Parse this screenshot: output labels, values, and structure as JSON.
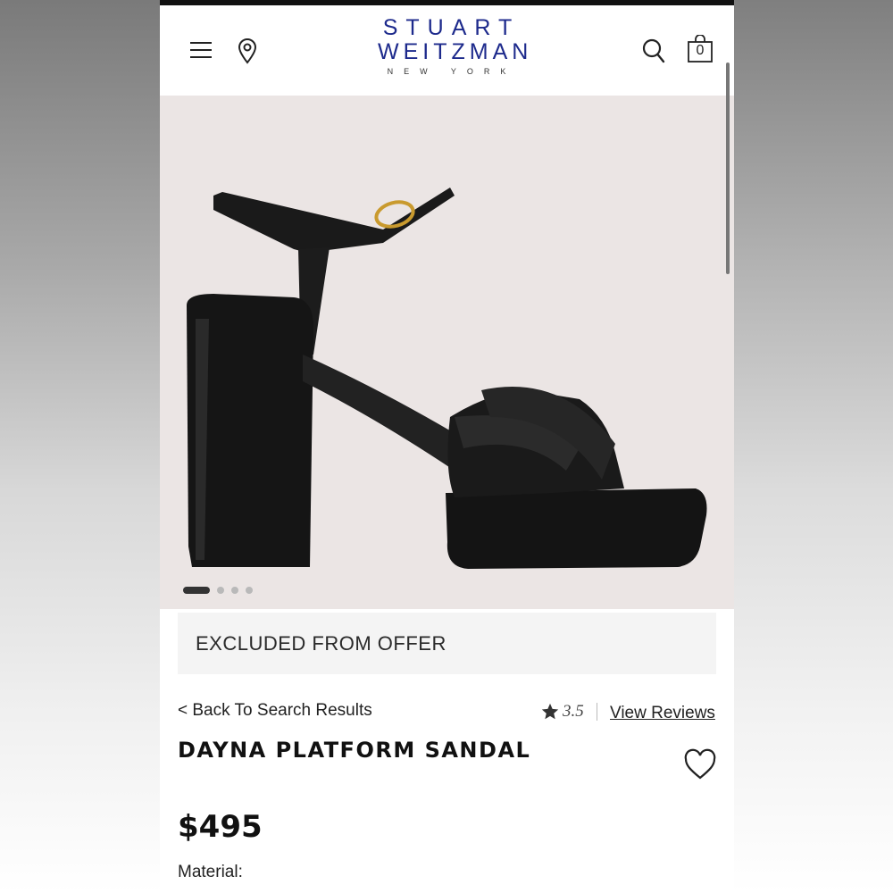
{
  "header": {
    "logo_line1": "STUART",
    "logo_line2": "WEITZMAN",
    "logo_line3": "NEW YORK",
    "cart_count": "0",
    "icons": [
      "menu-icon",
      "location-pin-icon",
      "search-icon",
      "shopping-bag-icon"
    ]
  },
  "gallery": {
    "image_count": 4,
    "active_index": 0
  },
  "offer": {
    "label": "EXCLUDED FROM OFFER"
  },
  "product": {
    "back_link": "< Back To Search Results",
    "rating": "3.5",
    "reviews_link": "View Reviews",
    "name": "DAYNA PLATFORM SANDAL",
    "price": "$495",
    "material_label": "Material:"
  },
  "colors": {
    "brand_blue": "#1d2a8c",
    "hero_background": "#ebe5e4",
    "offer_background": "#f4f4f4"
  }
}
